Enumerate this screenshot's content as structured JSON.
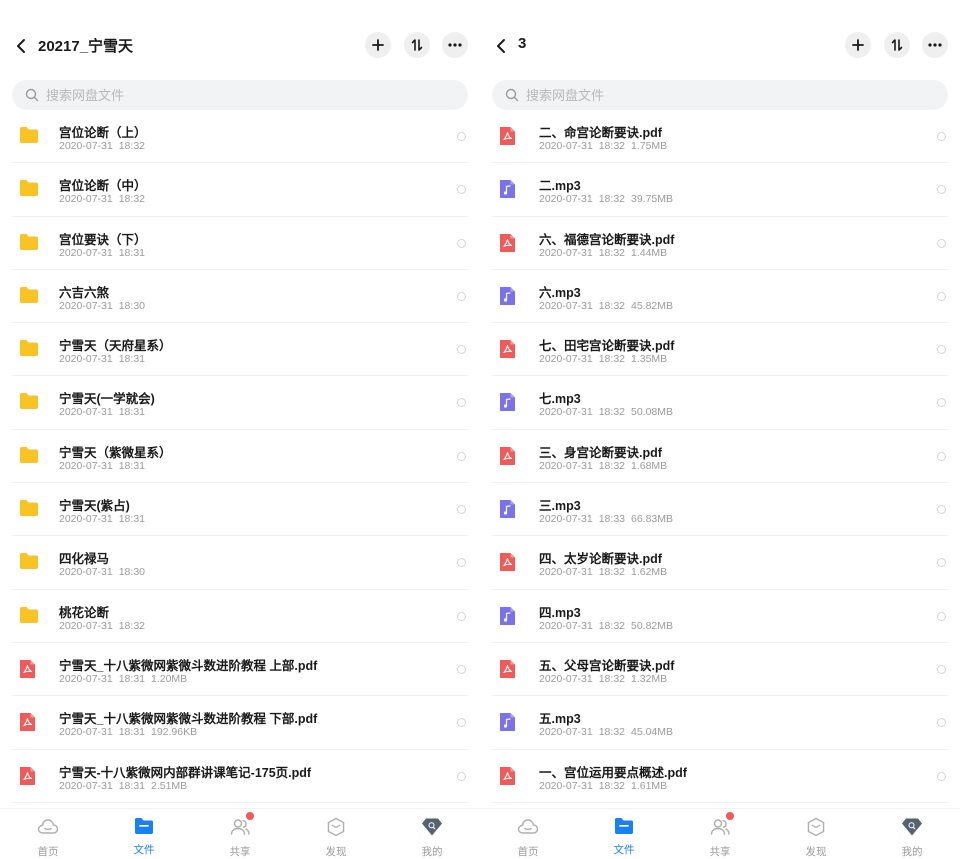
{
  "search_placeholder": "搜索网盘文件",
  "colors": {
    "accent": "#1a7ff0",
    "folder": "#f7c325",
    "pdf": "#ef5b5b",
    "mp3": "#7b72e9",
    "badge": "#f15a5a"
  },
  "screens": [
    {
      "title": "20217_宁雪天",
      "files": [
        {
          "type": "folder",
          "name": "宫位论断（上）",
          "date": "2020-07-31",
          "time": "18:32",
          "size": ""
        },
        {
          "type": "folder",
          "name": "宫位论断（中）",
          "date": "2020-07-31",
          "time": "18:32",
          "size": ""
        },
        {
          "type": "folder",
          "name": "宫位要诀（下）",
          "date": "2020-07-31",
          "time": "18:31",
          "size": ""
        },
        {
          "type": "folder",
          "name": "六吉六煞",
          "date": "2020-07-31",
          "time": "18:30",
          "size": ""
        },
        {
          "type": "folder",
          "name": "宁雪天（天府星系）",
          "date": "2020-07-31",
          "time": "18:31",
          "size": ""
        },
        {
          "type": "folder",
          "name": "宁雪天(一学就会)",
          "date": "2020-07-31",
          "time": "18:31",
          "size": ""
        },
        {
          "type": "folder",
          "name": "宁雪天（紫微星系）",
          "date": "2020-07-31",
          "time": "18:31",
          "size": ""
        },
        {
          "type": "folder",
          "name": "宁雪天(紫占)",
          "date": "2020-07-31",
          "time": "18:31",
          "size": ""
        },
        {
          "type": "folder",
          "name": "四化禄马",
          "date": "2020-07-31",
          "time": "18:30",
          "size": ""
        },
        {
          "type": "folder",
          "name": "桃花论断",
          "date": "2020-07-31",
          "time": "18:32",
          "size": ""
        },
        {
          "type": "pdf",
          "name": "宁雪天_十八紫微网紫微斗数进阶教程 上部.pdf",
          "date": "2020-07-31",
          "time": "18:31",
          "size": "1.20MB"
        },
        {
          "type": "pdf",
          "name": "宁雪天_十八紫微网紫微斗数进阶教程 下部.pdf",
          "date": "2020-07-31",
          "time": "18:31",
          "size": "192.96KB"
        },
        {
          "type": "pdf",
          "name": "宁雪天-十八紫微网内部群讲课笔记-175页.pdf",
          "date": "2020-07-31",
          "time": "18:31",
          "size": "2.51MB"
        }
      ]
    },
    {
      "title": "3",
      "files": [
        {
          "type": "pdf",
          "name": "二、命宫论断要诀.pdf",
          "date": "2020-07-31",
          "time": "18:32",
          "size": "1.75MB"
        },
        {
          "type": "mp3",
          "name": "二.mp3",
          "date": "2020-07-31",
          "time": "18:32",
          "size": "39.75MB"
        },
        {
          "type": "pdf",
          "name": "六、福德宫论断要诀.pdf",
          "date": "2020-07-31",
          "time": "18:32",
          "size": "1.44MB"
        },
        {
          "type": "mp3",
          "name": "六.mp3",
          "date": "2020-07-31",
          "time": "18:32",
          "size": "45.82MB"
        },
        {
          "type": "pdf",
          "name": "七、田宅宫论断要诀.pdf",
          "date": "2020-07-31",
          "time": "18:32",
          "size": "1.35MB"
        },
        {
          "type": "mp3",
          "name": "七.mp3",
          "date": "2020-07-31",
          "time": "18:32",
          "size": "50.08MB"
        },
        {
          "type": "pdf",
          "name": "三、身宫论断要诀.pdf",
          "date": "2020-07-31",
          "time": "18:32",
          "size": "1.68MB"
        },
        {
          "type": "mp3",
          "name": "三.mp3",
          "date": "2020-07-31",
          "time": "18:33",
          "size": "66.83MB"
        },
        {
          "type": "pdf",
          "name": "四、太岁论断要诀.pdf",
          "date": "2020-07-31",
          "time": "18:32",
          "size": "1.62MB"
        },
        {
          "type": "mp3",
          "name": "四.mp3",
          "date": "2020-07-31",
          "time": "18:32",
          "size": "50.82MB"
        },
        {
          "type": "pdf",
          "name": "五、父母宫论断要诀.pdf",
          "date": "2020-07-31",
          "time": "18:32",
          "size": "1.32MB"
        },
        {
          "type": "mp3",
          "name": "五.mp3",
          "date": "2020-07-31",
          "time": "18:32",
          "size": "45.04MB"
        },
        {
          "type": "pdf",
          "name": "一、宫位运用要点概述.pdf",
          "date": "2020-07-31",
          "time": "18:32",
          "size": "1.61MB"
        }
      ]
    }
  ],
  "tabs": [
    {
      "label": "首页",
      "icon": "cloud-icon",
      "active": false,
      "badge": false
    },
    {
      "label": "文件",
      "icon": "folder-icon",
      "active": true,
      "badge": false
    },
    {
      "label": "共享",
      "icon": "people-icon",
      "active": false,
      "badge": true
    },
    {
      "label": "发现",
      "icon": "box-icon",
      "active": false,
      "badge": false
    },
    {
      "label": "我的",
      "icon": "profile-diamond-icon",
      "active": false,
      "badge": false
    }
  ]
}
